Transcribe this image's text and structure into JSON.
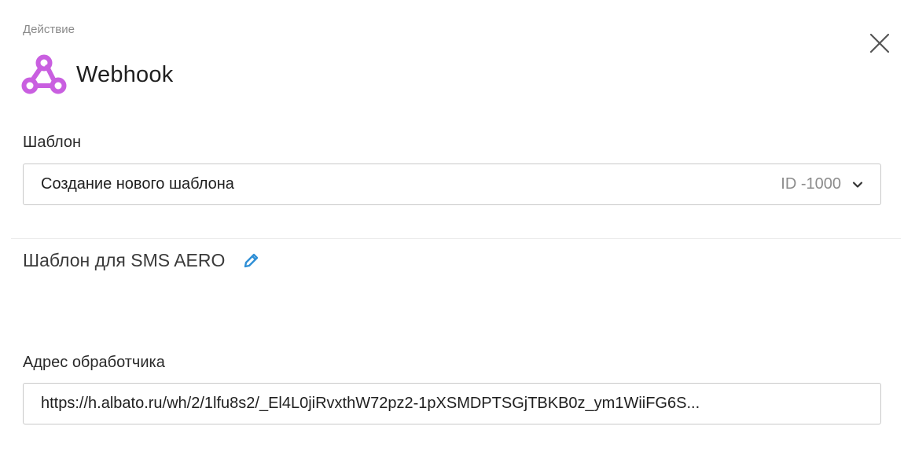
{
  "header": {
    "overline": "Действие",
    "title": "Webhook",
    "icon": "webhook-icon",
    "icon_color": "#c95fe0"
  },
  "template_select": {
    "label": "Шаблон",
    "value": "Создание нового шаблона",
    "id_text": "ID -1000"
  },
  "template_section": {
    "title": "Шаблон для SMS AERO",
    "edit_icon_color": "#2f8fd6"
  },
  "handler": {
    "label": "Адрес обработчика",
    "url": "https://h.albato.ru/wh/2/1lfu8s2/_El4L0jiRvxthW72pz2-1pXSMDPTSGjTBKB0z_ym1WiiFG6S..."
  }
}
